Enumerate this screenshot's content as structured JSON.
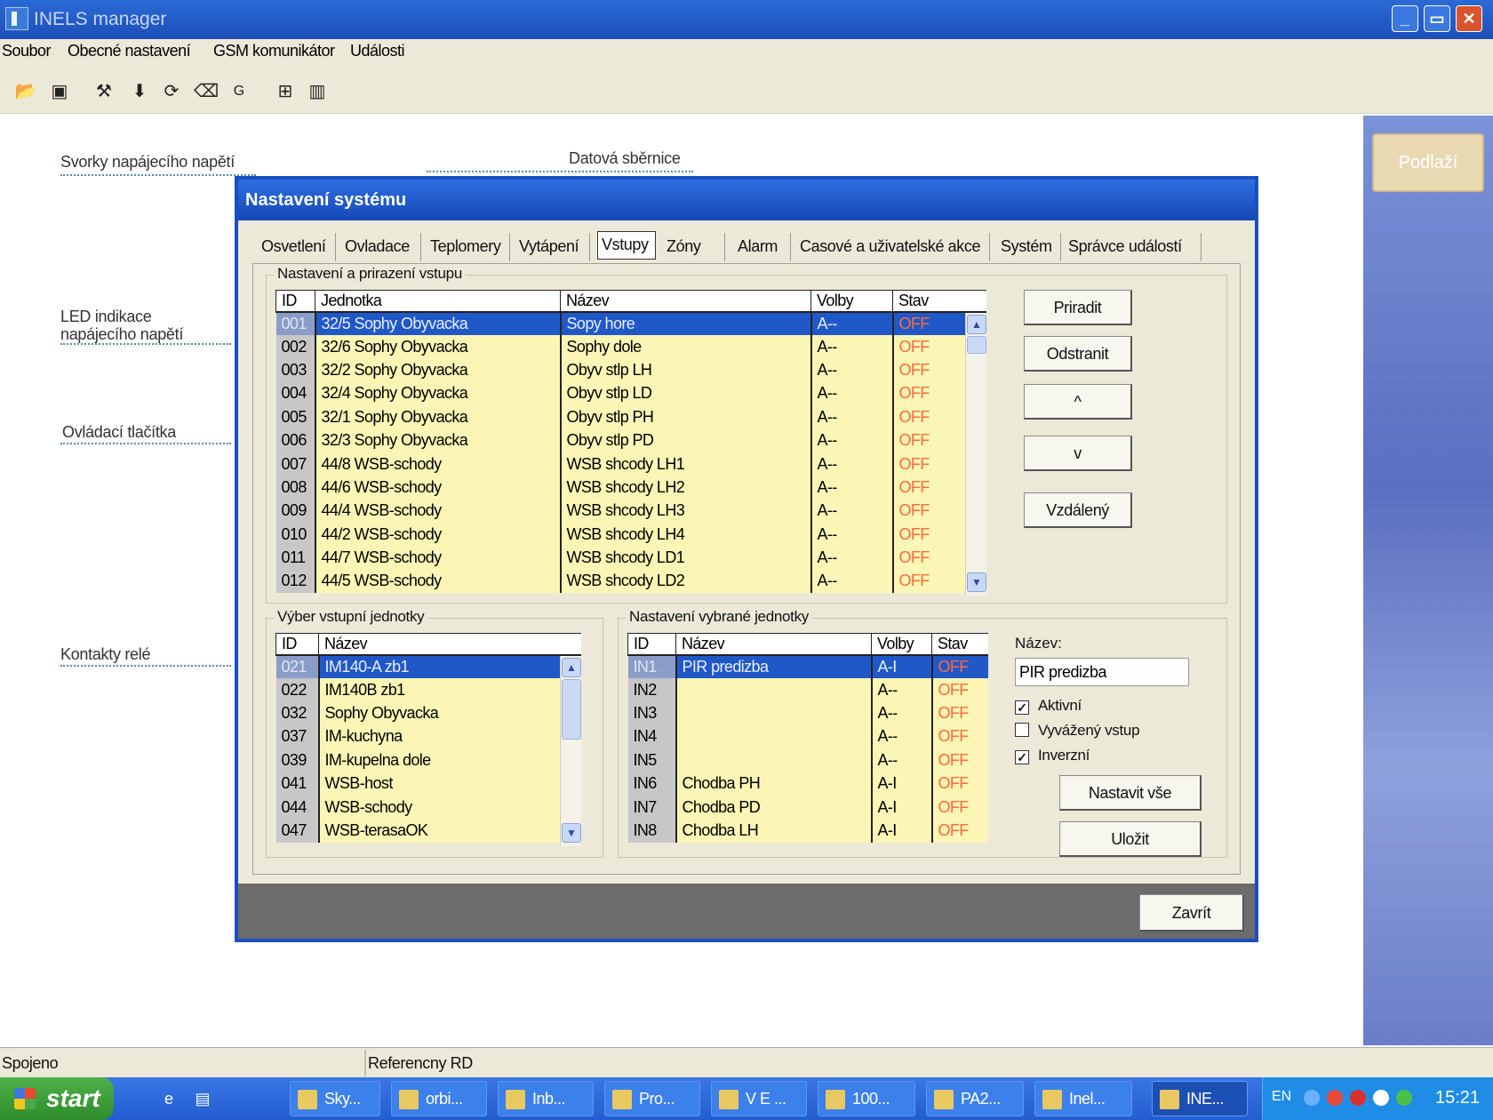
{
  "window": {
    "title": "INELS manager"
  },
  "menu": [
    "Soubor",
    "Obecné nastavení",
    "GSM komunikátor",
    "Události"
  ],
  "toolbar_icons": [
    "open-folder-icon",
    "save-icon",
    "tools-icon",
    "download-arrow-icon",
    "refresh-icon",
    "eraser-icon",
    "gsm-icon",
    "network-icon",
    "book-icon"
  ],
  "annotations": {
    "svorky": "Svorky napájecího napětí",
    "datova": "Datová sběrnice",
    "led_1": "LED indikace",
    "led_2": "napájecího napětí",
    "ovladaci": "Ovládací tlačítka",
    "kontakty": "Kontakty relé"
  },
  "side_button": "Podlaží",
  "dialog": {
    "title": "Nastavení systému",
    "tabs": [
      "Osvetlení",
      "Ovladace",
      "Teplomery",
      "Vytápení",
      "Vstupy",
      "Zóny",
      "Alarm",
      "Casové a uživatelské akce",
      "Systém",
      "Správce událostí"
    ],
    "active_tab": "Vstupy",
    "inputs_group": {
      "title": "Nastavení a prirazení vstupu",
      "headers": [
        "ID",
        "Jednotka",
        "Název",
        "Volby",
        "Stav"
      ],
      "rows": [
        [
          "001",
          "32/5 Sophy Obyvacka",
          "Sopy hore",
          "A--",
          "OFF"
        ],
        [
          "002",
          "32/6 Sophy Obyvacka",
          "Sophy dole",
          "A--",
          "OFF"
        ],
        [
          "003",
          "32/2 Sophy Obyvacka",
          "Obyv stlp LH",
          "A--",
          "OFF"
        ],
        [
          "004",
          "32/4 Sophy Obyvacka",
          "Obyv stlp LD",
          "A--",
          "OFF"
        ],
        [
          "005",
          "32/1 Sophy Obyvacka",
          "Obyv stlp PH",
          "A--",
          "OFF"
        ],
        [
          "006",
          "32/3 Sophy Obyvacka",
          "Obyv stlp PD",
          "A--",
          "OFF"
        ],
        [
          "007",
          "44/8 WSB-schody",
          "WSB shcody LH1",
          "A--",
          "OFF"
        ],
        [
          "008",
          "44/6 WSB-schody",
          "WSB shcody LH2",
          "A--",
          "OFF"
        ],
        [
          "009",
          "44/4 WSB-schody",
          "WSB shcody LH3",
          "A--",
          "OFF"
        ],
        [
          "010",
          "44/2 WSB-schody",
          "WSB shcody LH4",
          "A--",
          "OFF"
        ],
        [
          "011",
          "44/7 WSB-schody",
          "WSB shcody LD1",
          "A--",
          "OFF"
        ],
        [
          "012",
          "44/5 WSB-schody",
          "WSB shcody LD2",
          "A--",
          "OFF"
        ]
      ],
      "buttons": [
        "Priradit",
        "Odstranit",
        "^",
        "v",
        "Vzdálený"
      ]
    },
    "unit_select": {
      "title": "Výber vstupní jednotky",
      "headers": [
        "ID",
        "Název"
      ],
      "rows": [
        [
          "021",
          "IM140-A zb1"
        ],
        [
          "022",
          "IM140B zb1"
        ],
        [
          "032",
          "Sophy Obyvacka"
        ],
        [
          "037",
          "IM-kuchyna"
        ],
        [
          "039",
          "IM-kupelna dole"
        ],
        [
          "041",
          "WSB-host"
        ],
        [
          "044",
          "WSB-schody"
        ],
        [
          "047",
          "WSB-terasaOK"
        ]
      ]
    },
    "unit_settings": {
      "title": "Nastavení vybrané jednotky",
      "headers": [
        "ID",
        "Název",
        "Volby",
        "Stav"
      ],
      "rows": [
        [
          "IN1",
          "PIR predizba",
          "A-I",
          "OFF"
        ],
        [
          "IN2",
          "",
          "A--",
          "OFF"
        ],
        [
          "IN3",
          "",
          "A--",
          "OFF"
        ],
        [
          "IN4",
          "",
          "A--",
          "OFF"
        ],
        [
          "IN5",
          "",
          "A--",
          "OFF"
        ],
        [
          "IN6",
          "Chodba PH",
          "A-I",
          "OFF"
        ],
        [
          "IN7",
          "Chodba PD",
          "A-I",
          "OFF"
        ],
        [
          "IN8",
          "Chodba LH",
          "A-I",
          "OFF"
        ]
      ],
      "name_label": "Název:",
      "name_value": "PIR predizba",
      "checkboxes": [
        {
          "label": "Aktivní",
          "checked": true
        },
        {
          "label": "Vyvážený vstup",
          "checked": false
        },
        {
          "label": "Inverzní",
          "checked": true
        }
      ],
      "set_all": "Nastavit vše",
      "save": "Uložit"
    },
    "close": "Zavrít"
  },
  "status": {
    "left": "Spojeno",
    "right": "Referencny RD"
  },
  "taskbar": {
    "start": "start",
    "tasks": [
      "Sky...",
      "orbi...",
      "Inb...",
      "Pro...",
      "V E ...",
      "100...",
      "PA2...",
      "Inel...",
      "INE..."
    ],
    "lang": "EN",
    "clock": "15:21"
  },
  "colors": {
    "titlebar": "#2a6ad6",
    "selected_row": "#2158c8",
    "grid_bg": "#fbf6b5",
    "off_text": "#ff6a3a"
  }
}
